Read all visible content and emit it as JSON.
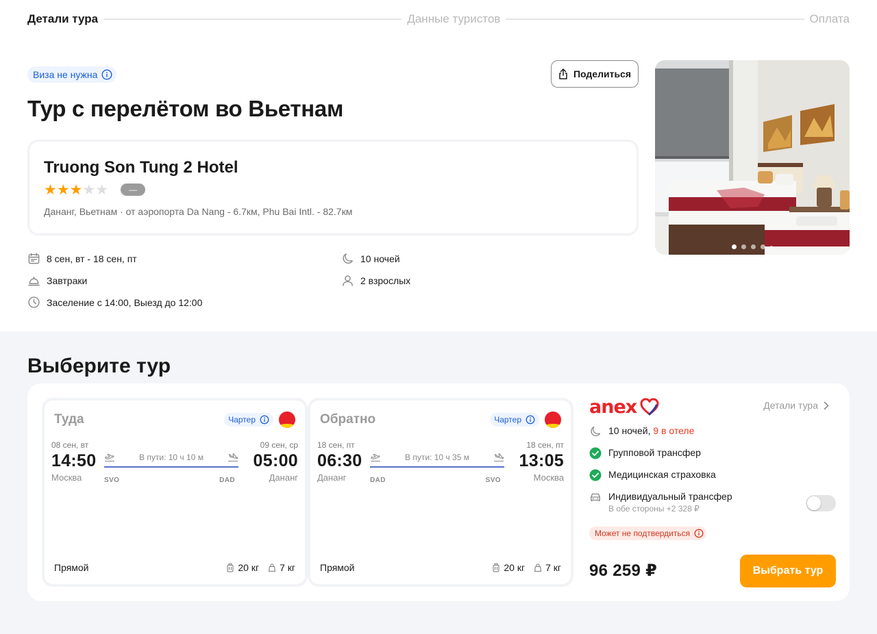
{
  "stepper": {
    "steps": [
      {
        "label": "Детали тура"
      },
      {
        "label": "Данные туристов"
      },
      {
        "label": "Оплата"
      }
    ]
  },
  "header": {
    "visa_badge": "Виза не нужна",
    "share_label": "Поделиться",
    "title": "Тур с перелётом во Вьетнам"
  },
  "hotel": {
    "name": "Truong Son Tung 2 Hotel",
    "stars": 3,
    "max_stars": 5,
    "rating": "—",
    "location": "Дананг, Вьетнам · от аэропорта Da Nang - 6.7км, Phu Bai Intl. - 82.7км"
  },
  "facts": {
    "dates": "8 сен, вт - 18 сен, пт",
    "nights": "10 ночей",
    "meals": "Завтраки",
    "guests": "2 взрослых",
    "checkin": "Заселение с 14:00, Выезд до 12:00"
  },
  "gallery": {
    "dot_count": 5,
    "active_index": 0
  },
  "select_section": {
    "title": "Выберите тур"
  },
  "flights": [
    {
      "direction": "Туда",
      "charter_label": "Чартер",
      "dep_date": "08 сен, вт",
      "dep_time": "14:50",
      "dep_city": "Москва",
      "dep_code": "SVO",
      "duration": "В пути: 10 ч 10 м",
      "arr_date": "09 сен, ср",
      "arr_time": "05:00",
      "arr_city": "Дананг",
      "arr_code": "DAD",
      "type": "Прямой",
      "baggage": "20 кг",
      "hand_luggage": "7 кг"
    },
    {
      "direction": "Обратно",
      "charter_label": "Чартер",
      "dep_date": "18 сен, пт",
      "dep_time": "06:30",
      "dep_city": "Дананг",
      "dep_code": "DAD",
      "duration": "В пути: 10 ч 35 м",
      "arr_date": "18 сен, пт",
      "arr_time": "13:05",
      "arr_city": "Москва",
      "arr_code": "SVO",
      "type": "Прямой",
      "baggage": "20 кг",
      "hand_luggage": "7 кг"
    }
  ],
  "summary": {
    "operator": "anex",
    "details_link": "Детали тура",
    "nights": "10 ночей,",
    "nights_in_hotel": "9 в отеле",
    "group_transfer": "Групповой трансфер",
    "insurance": "Медицинская страховка",
    "individual_transfer": "Индивидуальный трансфер",
    "individual_transfer_sub": "В обе стороны +2 328 ₽",
    "individual_transfer_enabled": false,
    "warning": "Может не подтвердиться",
    "price": "96 259 ₽",
    "choose_label": "Выбрать тур"
  },
  "colors": {
    "accent": "#ff9d00",
    "link_blue": "#1a5fd8",
    "success_green": "#1faa59",
    "warning_red": "#e8391f",
    "brand_red": "#e8252a"
  }
}
